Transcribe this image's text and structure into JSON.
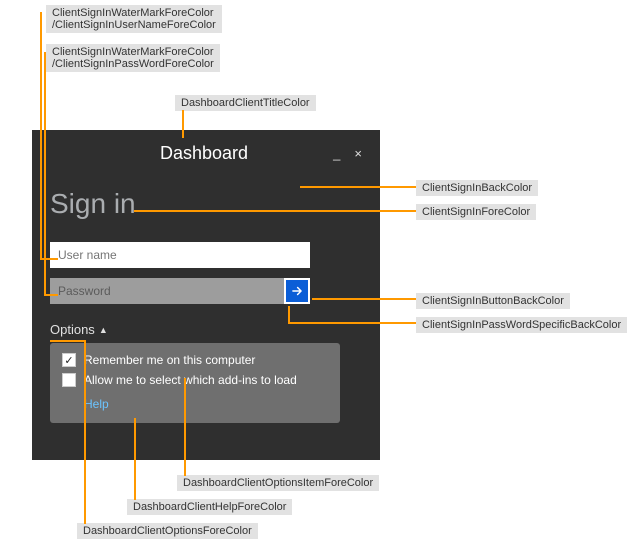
{
  "labels": {
    "wm_fore_user": "ClientSignInWaterMarkForeColor\n/ClientSignInUserNameForeColor",
    "wm_fore_pass": "ClientSignInWaterMarkForeColor\n/ClientSignInPassWordForeColor",
    "title_color": "DashboardClientTitleColor",
    "back_color": "ClientSignInBackColor",
    "fore_color": "ClientSignInForeColor",
    "btn_back": "ClientSignInButtonBackColor",
    "pw_back": "ClientSignInPassWordSpecificBackColor",
    "opt_item_fore": "DashboardClientOptionsItemForeColor",
    "help_fore": "DashboardClientHelpForeColor",
    "opt_fore": "DashboardClientOptionsForeColor"
  },
  "dash": {
    "title": "Dashboard",
    "signin_heading": "Sign in",
    "user_placeholder": "User name",
    "pass_placeholder": "Password",
    "options_label": "Options",
    "remember": "Remember me on this computer",
    "select_addins": "Allow me to select which add-ins to load",
    "help": "Help"
  },
  "colors": {
    "window_bg": "#2f2f2f",
    "signin_fore": "#aaadb0",
    "pw_bg": "#9d9d9d",
    "btn_bg": "#0b5ed7",
    "options_panel_bg": "#6f6f6f",
    "help_link": "#6cc4ff",
    "connector": "#ff9900",
    "label_bg": "#e2e2e2"
  }
}
